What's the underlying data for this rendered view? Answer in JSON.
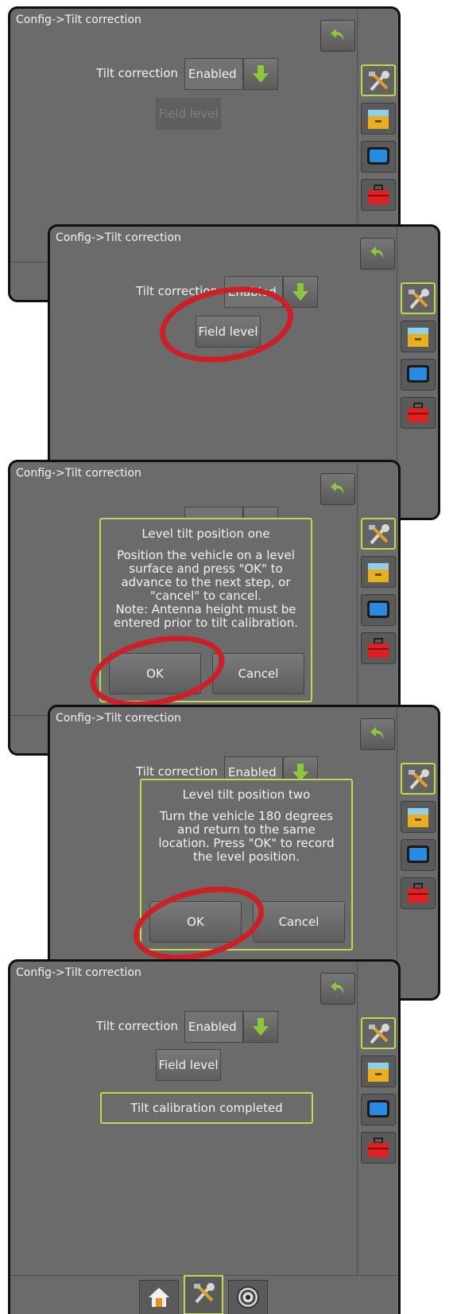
{
  "screen_title": "Config->Tilt correction",
  "tilt_label": "Tilt correction",
  "tilt_value": "Enabled",
  "field_level_label": "Field level",
  "dialog_one": {
    "title": "Level tilt position one",
    "lines": [
      "Position the vehicle on a level",
      "surface and press \"OK\" to",
      "advance to the next step, or",
      "\"cancel\" to cancel.",
      "Note: Antenna height must be",
      "entered prior to tilt calibration."
    ],
    "ok": "OK",
    "cancel": "Cancel"
  },
  "dialog_two": {
    "title": "Level tilt position two",
    "lines": [
      "Turn the vehicle 180 degrees",
      "and return to the same",
      "location.  Press \"OK\" to record",
      "the level position."
    ],
    "ok": "OK",
    "cancel": "Cancel"
  },
  "completion_message": "Tilt calibration completed",
  "sidebar_icons": [
    "tools-icon",
    "drawer-icon",
    "monitor-icon",
    "toolbox-icon"
  ],
  "bottom_tabs": [
    "home-icon",
    "tools-icon",
    "gauge-icon"
  ],
  "colors": {
    "accent": "#c0d84a",
    "highlight_ellipse": "#cc1f26",
    "panel": "#6b6b6b",
    "arrow_green": "#8cc63f"
  }
}
